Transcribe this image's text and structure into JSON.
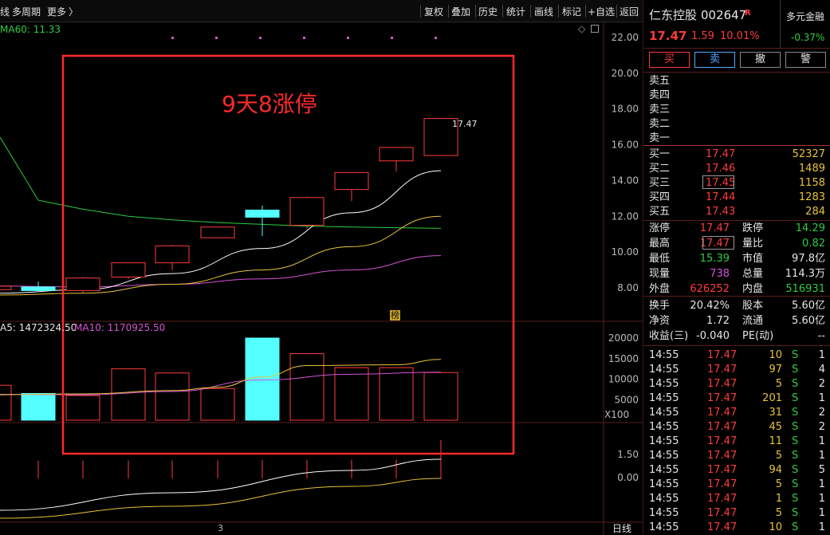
{
  "toolbar": {
    "left_cut": "线",
    "multi_period": "多周期",
    "more": "更多",
    "more_arrow": "〉",
    "buttons": [
      "复权",
      "叠加",
      "历史",
      "统计",
      "画线",
      "标记",
      "+自选",
      "返回"
    ]
  },
  "chart": {
    "ma60_label": "MA60: 11.33",
    "price_axis": [
      "22.00",
      "20.00",
      "18.00",
      "16.00",
      "14.00",
      "12.00",
      "10.00",
      "8.00"
    ],
    "annotation": "9天8涨停",
    "last_price_tag": "17.47",
    "badge": "榜",
    "volume_legend_ma5": "A5: 1472324.50",
    "volume_legend_ma10": "MA10: 1170925.50",
    "volume_axis": [
      "20000",
      "15000",
      "10000",
      "5000"
    ],
    "volume_unit": "X100",
    "ind_axis": [
      "1.50",
      "0.00"
    ],
    "x_label": "3",
    "period": "日线",
    "colors": {
      "up": "#ff3b3b",
      "down": "#54ffff",
      "ma5": "#ffffff",
      "ma10": "#e8c33a",
      "ma20": "#d653d6",
      "ma60": "#2ecc40",
      "box": "#ff2a2a"
    }
  },
  "chart_data": {
    "type": "candlestick",
    "title": "",
    "ylim": [
      7,
      23
    ],
    "candles": [
      {
        "o": 8.05,
        "h": 8.35,
        "l": 7.85,
        "c": 7.85,
        "dir": "down"
      },
      {
        "o": 7.85,
        "h": 8.6,
        "l": 7.7,
        "c": 8.55,
        "dir": "up"
      },
      {
        "o": 8.6,
        "h": 9.4,
        "l": 8.5,
        "c": 9.4,
        "dir": "up"
      },
      {
        "o": 9.4,
        "h": 10.4,
        "l": 9.0,
        "c": 10.35,
        "dir": "up"
      },
      {
        "o": 10.8,
        "h": 11.4,
        "l": 10.8,
        "c": 11.4,
        "dir": "up"
      },
      {
        "o": 12.35,
        "h": 12.6,
        "l": 10.9,
        "c": 11.95,
        "dir": "down"
      },
      {
        "o": 11.5,
        "h": 13.1,
        "l": 11.3,
        "c": 13.05,
        "dir": "up"
      },
      {
        "o": 13.5,
        "h": 14.45,
        "l": 12.85,
        "c": 14.45,
        "dir": "up"
      },
      {
        "o": 15.1,
        "h": 15.85,
        "l": 14.5,
        "c": 15.85,
        "dir": "up"
      },
      {
        "o": 15.4,
        "h": 17.47,
        "l": 15.39,
        "c": 17.47,
        "dir": "up"
      }
    ],
    "ma60": [
      12.9,
      12.4,
      12.0,
      11.8,
      11.65,
      11.55,
      11.45,
      11.4,
      11.36,
      11.33
    ],
    "volume": [
      {
        "v": 6500,
        "dir": "down"
      },
      {
        "v": 6000,
        "dir": "up"
      },
      {
        "v": 12500,
        "dir": "up"
      },
      {
        "v": 11500,
        "dir": "up"
      },
      {
        "v": 7700,
        "dir": "up"
      },
      {
        "v": 20000,
        "dir": "down"
      },
      {
        "v": 16200,
        "dir": "up"
      },
      {
        "v": 12800,
        "dir": "up"
      },
      {
        "v": 12800,
        "dir": "up"
      },
      {
        "v": 11600,
        "dir": "up"
      }
    ]
  },
  "quote": {
    "name": "仁东控股",
    "code": "002647",
    "flag": "R",
    "index_name": "多元金融",
    "index_change": "-0.37%",
    "price": "17.47",
    "change": "1.59",
    "change_pct": "10.01%",
    "actions": [
      "买",
      "卖",
      "撤",
      "警"
    ],
    "sell_levels": [
      "卖五",
      "卖四",
      "卖三",
      "卖二",
      "卖一"
    ],
    "buy_levels": [
      {
        "label": "买一",
        "price": "17.47",
        "vol": "52327"
      },
      {
        "label": "买二",
        "price": "17.46",
        "vol": "1489"
      },
      {
        "label": "买三",
        "price": "17.45",
        "vol": "1158"
      },
      {
        "label": "买四",
        "price": "17.44",
        "vol": "1283"
      },
      {
        "label": "买五",
        "price": "17.43",
        "vol": "284"
      }
    ],
    "stats_left": [
      {
        "label": "涨停",
        "value": "17.47",
        "color": "red"
      },
      {
        "label": "最高",
        "value": "17.47",
        "color": "red"
      },
      {
        "label": "最低",
        "value": "15.39",
        "color": "green"
      },
      {
        "label": "现量",
        "value": "738",
        "color": "purple"
      },
      {
        "label": "外盘",
        "value": "626252",
        "color": "red"
      }
    ],
    "stats_right": [
      {
        "label": "跌停",
        "value": "14.29",
        "color": "green"
      },
      {
        "label": "量比",
        "value": "0.82",
        "color": "green"
      },
      {
        "label": "市值",
        "value": "97.8亿",
        "color": "white"
      },
      {
        "label": "总量",
        "value": "114.3万",
        "color": "white"
      },
      {
        "label": "内盘",
        "value": "516931",
        "color": "green"
      }
    ],
    "fin_left": [
      {
        "label": "换手",
        "value": "20.42%"
      },
      {
        "label": "净资",
        "value": "1.72"
      },
      {
        "label": "收益(三)",
        "value": "-0.040"
      }
    ],
    "fin_right": [
      {
        "label": "股本",
        "value": "5.60亿"
      },
      {
        "label": "流通",
        "value": "5.60亿"
      },
      {
        "label": "PE(动)",
        "value": "--"
      }
    ]
  },
  "ticks": [
    {
      "time": "14:55",
      "price": "17.47",
      "vol": "10",
      "side": "S",
      "n": "1"
    },
    {
      "time": "14:55",
      "price": "17.47",
      "vol": "97",
      "side": "S",
      "n": "4"
    },
    {
      "time": "14:55",
      "price": "17.47",
      "vol": "5",
      "side": "S",
      "n": "2"
    },
    {
      "time": "14:55",
      "price": "17.47",
      "vol": "201",
      "side": "S",
      "n": "1"
    },
    {
      "time": "14:55",
      "price": "17.47",
      "vol": "31",
      "side": "S",
      "n": "2"
    },
    {
      "time": "14:55",
      "price": "17.47",
      "vol": "45",
      "side": "S",
      "n": "2"
    },
    {
      "time": "14:55",
      "price": "17.47",
      "vol": "11",
      "side": "S",
      "n": "1"
    },
    {
      "time": "14:55",
      "price": "17.47",
      "vol": "5",
      "side": "S",
      "n": "1"
    },
    {
      "time": "14:55",
      "price": "17.47",
      "vol": "94",
      "side": "S",
      "n": "5"
    },
    {
      "time": "14:55",
      "price": "17.47",
      "vol": "5",
      "side": "S",
      "n": "1"
    },
    {
      "time": "14:55",
      "price": "17.47",
      "vol": "1",
      "side": "S",
      "n": "1"
    },
    {
      "time": "14:55",
      "price": "17.47",
      "vol": "5",
      "side": "S",
      "n": "1"
    },
    {
      "time": "14:55",
      "price": "17.47",
      "vol": "10",
      "side": "S",
      "n": "1"
    }
  ]
}
